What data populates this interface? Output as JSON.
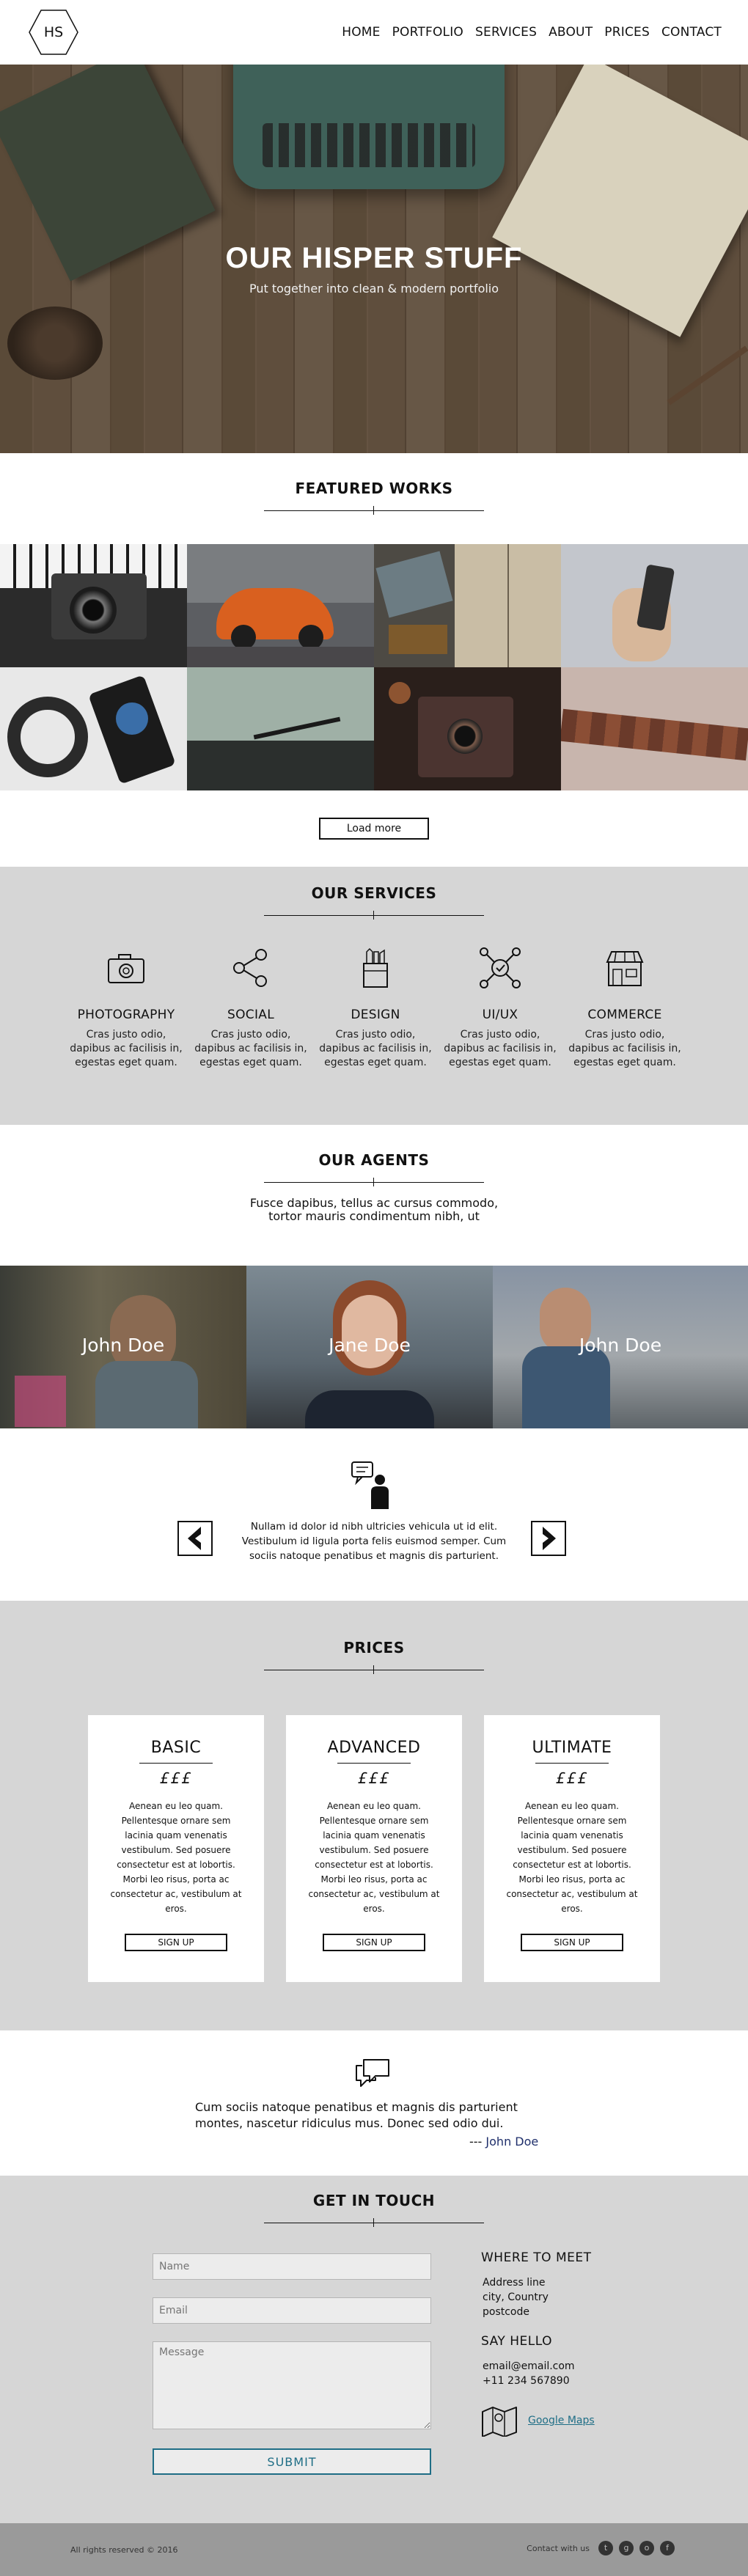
{
  "header": {
    "logo_text": "HS",
    "nav": [
      "HOME",
      "PORTFOLIO",
      "SERVICES",
      "ABOUT",
      "PRICES",
      "CONTACT"
    ]
  },
  "hero": {
    "title": "OUR HISPER STUFF",
    "subtitle": "Put together into clean & modern portfolio"
  },
  "featured": {
    "title": "FEATURED WORKS",
    "load_more": "Load more"
  },
  "services": {
    "title": "OUR SERVICES",
    "items": [
      {
        "name": "PHOTOGRAPHY",
        "desc": "Cras justo odio, dapibus ac facilisis in, egestas eget quam.",
        "icon": "camera-icon"
      },
      {
        "name": "SOCIAL",
        "desc": "Cras justo odio, dapibus ac facilisis in, egestas eget quam.",
        "icon": "share-icon"
      },
      {
        "name": "DESIGN",
        "desc": "Cras justo odio, dapibus ac facilisis in, egestas eget quam.",
        "icon": "pencil-cup-icon"
      },
      {
        "name": "UI/UX",
        "desc": "Cras justo odio, dapibus ac facilisis in, egestas eget quam.",
        "icon": "network-check-icon"
      },
      {
        "name": "COMMERCE",
        "desc": "Cras justo odio, dapibus ac facilisis in, egestas eget quam.",
        "icon": "shop-icon"
      }
    ]
  },
  "agents": {
    "title": "OUR AGENTS",
    "text": "Fusce dapibus, tellus ac cursus commodo, tortor mauris condimentum nibh, ut",
    "people": [
      "John Doe",
      "Jane Doe",
      "John Doe"
    ]
  },
  "testimonial": {
    "text": "Nullam id dolor id nibh ultricies vehicula ut id elit. Vestibulum id ligula porta felis euismod semper. Cum sociis natoque penatibus et magnis dis parturient."
  },
  "prices": {
    "title": "PRICES",
    "plans": [
      {
        "name": "BASIC",
        "price": "£££",
        "desc": "Aenean eu leo quam. Pellentesque ornare sem lacinia quam venenatis vestibulum. Sed posuere consectetur est at lobortis. Morbi leo risus, porta ac consectetur ac, vestibulum at eros.",
        "button": "SIGN UP"
      },
      {
        "name": "ADVANCED",
        "price": "£££",
        "desc": "Aenean eu leo quam. Pellentesque ornare sem lacinia quam venenatis vestibulum. Sed posuere consectetur est at lobortis. Morbi leo risus, porta ac consectetur ac, vestibulum at eros.",
        "button": "SIGN UP"
      },
      {
        "name": "ULTIMATE",
        "price": "£££",
        "desc": "Aenean eu leo quam. Pellentesque ornare sem lacinia quam venenatis vestibulum. Sed posuere consectetur est at lobortis. Morbi leo risus, porta ac consectetur ac, vestibulum at eros.",
        "button": "SIGN UP"
      }
    ]
  },
  "quote": {
    "text": "Cum sociis natoque penatibus et magnis dis parturient montes, nascetur ridiculus mus. Donec sed odio dui.",
    "dashes": "---",
    "author": "John Doe"
  },
  "contact": {
    "title": "GET IN TOUCH",
    "name_placeholder": "Name",
    "email_placeholder": "Email",
    "message_placeholder": "Message",
    "submit": "SUBMIT",
    "where_title": "WHERE TO MEET",
    "address": [
      "Address line",
      "city, Country",
      "postcode"
    ],
    "hello_title": "SAY HELLO",
    "email": "email@email.com",
    "phone": "+11 234 567890",
    "map_link": "Google Maps"
  },
  "footer": {
    "copyright": "All rights reserved © 2016",
    "contact_label": "Contact with us",
    "social": [
      {
        "icon": "twitter-icon",
        "glyph": "t"
      },
      {
        "icon": "google-plus-icon",
        "glyph": "g"
      },
      {
        "icon": "github-icon",
        "glyph": "o"
      },
      {
        "icon": "facebook-icon",
        "glyph": "f"
      }
    ]
  }
}
